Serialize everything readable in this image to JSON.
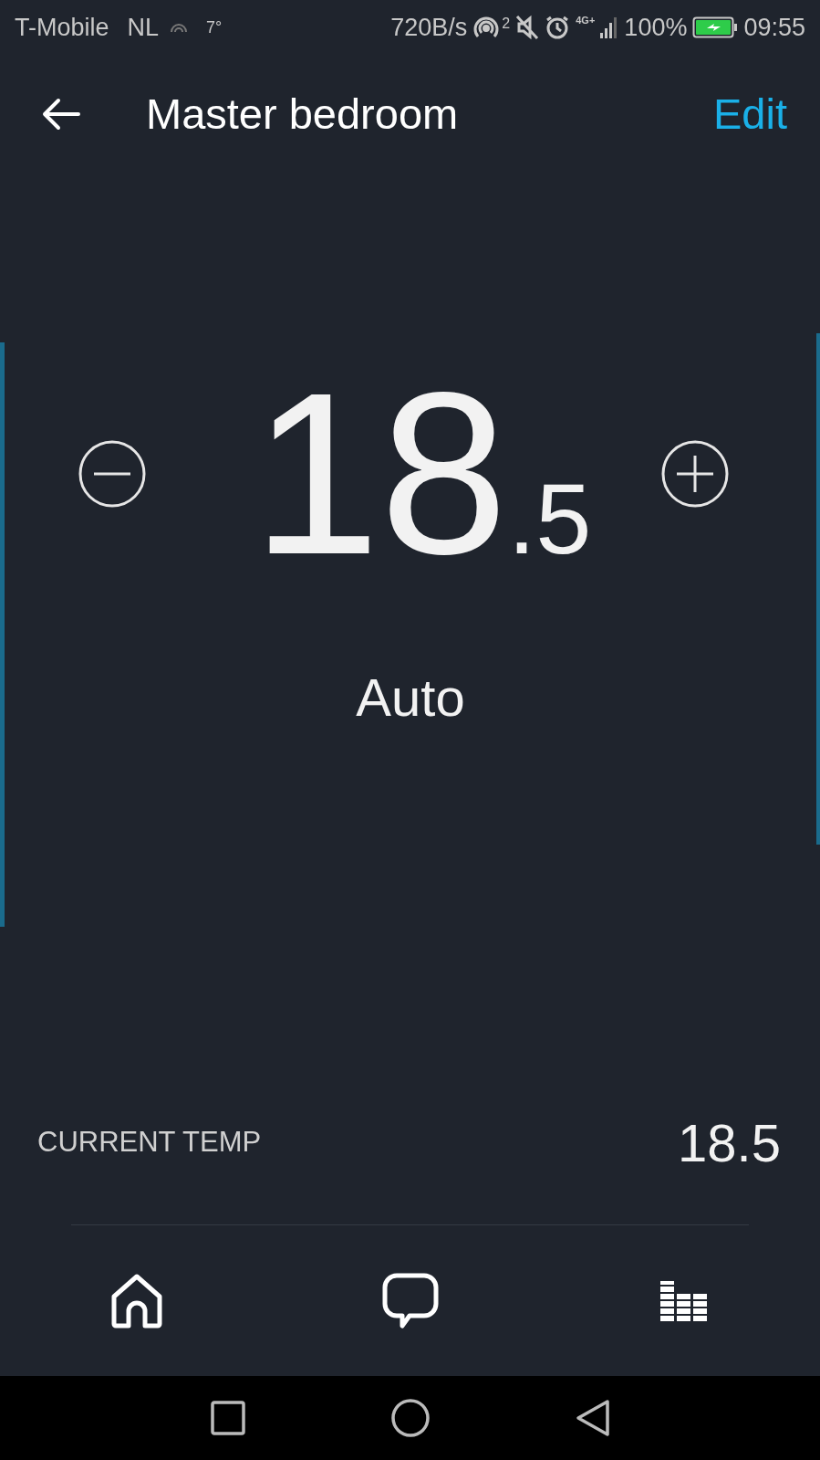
{
  "status_bar": {
    "carrier": "T-Mobile",
    "region": "NL",
    "weather": "7°",
    "speed": "720B/s",
    "hotspot_count": "2",
    "network": "4G+",
    "battery": "100%",
    "time": "09:55"
  },
  "header": {
    "title": "Master bedroom",
    "action": "Edit"
  },
  "thermostat": {
    "whole": "18",
    "fraction": ".5",
    "mode": "Auto"
  },
  "current_temp": {
    "label": "CURRENT TEMP",
    "value": "18.5"
  },
  "bottom_nav": [
    {
      "kind": "home"
    },
    {
      "kind": "chat"
    },
    {
      "kind": "equalizer"
    }
  ]
}
